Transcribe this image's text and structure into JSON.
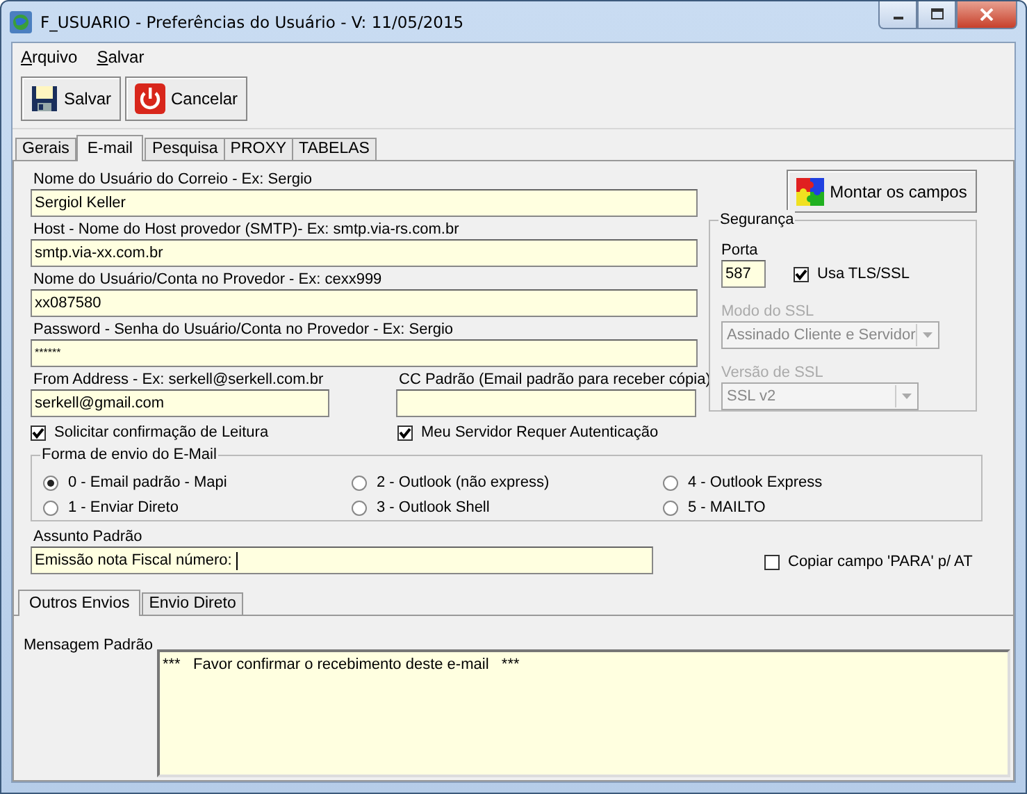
{
  "window": {
    "title": "F_USUARIO - Preferências do Usuário - V: 11/05/2015"
  },
  "menu": [
    {
      "label": "Arquivo"
    },
    {
      "label": "Salvar"
    }
  ],
  "toolbar": [
    {
      "label": "Salvar",
      "kind": "save"
    },
    {
      "label": "Cancelar",
      "kind": "cancel"
    }
  ],
  "tabs": [
    {
      "label": "Gerais",
      "selected": false
    },
    {
      "label": "E-mail",
      "selected": true
    },
    {
      "label": "Pesquisa",
      "selected": false
    },
    {
      "label": "PROXY",
      "selected": false
    },
    {
      "label": "TABELAS",
      "selected": false
    }
  ],
  "fields": [
    {
      "label": "Nome do Usuário do Correio - Ex: Sergio",
      "value": "Sergiol Keller",
      "kind": "text"
    },
    {
      "label": "Host - Nome do Host provedor (SMTP)- Ex: smtp.via-rs.com.br",
      "value": "smtp.via-xx.com.br",
      "kind": "text"
    },
    {
      "label": "Nome do Usuário/Conta no Provedor - Ex: cexx999",
      "value": "xx087580",
      "kind": "text"
    },
    {
      "label": "Password - Senha do Usuário/Conta no Provedor - Ex: Sergio",
      "value": "******",
      "kind": "password"
    }
  ],
  "from_address": {
    "label": "From Address - Ex: serkell@serkell.com.br",
    "value": "serkell@gmail.com"
  },
  "cc": {
    "label": "CC Padrão (Email padrão para receber cópia)"
  },
  "read_receipt": {
    "label": "Solicitar confirmação de Leitura",
    "checked": true
  },
  "server_auth": {
    "label": "Meu Servidor Requer Autenticação",
    "checked": true
  },
  "build_button": {
    "label": "Montar os campos"
  },
  "security": {
    "title": "Segurança",
    "port": {
      "label": "Porta",
      "value": "587"
    },
    "tls": {
      "label": "Usa TLS/SSL",
      "checked": true
    },
    "ssl_mode": {
      "label": "Modo do SSL",
      "value": "Assinado Cliente e Servidor",
      "disabled": true
    },
    "ssl_version": {
      "label": "Versão de SSL",
      "value": "SSL v2",
      "disabled": true
    }
  },
  "send_method": {
    "title": "Forma de envio do E-Mail",
    "options": [
      {
        "label": "0 - Email padrão - Mapi",
        "selected": true
      },
      {
        "label": "1 - Enviar Direto",
        "selected": false
      },
      {
        "label": "2 - Outlook (não express)",
        "selected": false
      },
      {
        "label": "3 - Outlook Shell",
        "selected": false
      },
      {
        "label": "4 - Outlook Express",
        "selected": false
      },
      {
        "label": "5 - MAILTO",
        "selected": false
      }
    ]
  },
  "subject": {
    "label": "Assunto Padrão",
    "value": "Emissão nota Fiscal número: "
  },
  "copy_para": {
    "label": "Copiar campo 'PARA' p/ AT",
    "checked": false
  },
  "subtabs": [
    {
      "label": "Outros Envios",
      "selected": true
    },
    {
      "label": "Envio Direto",
      "selected": false
    }
  ],
  "message": {
    "label": "Mensagem Padrão",
    "value": "***   Favor confirmar o recebimento deste e-mail   ***"
  }
}
